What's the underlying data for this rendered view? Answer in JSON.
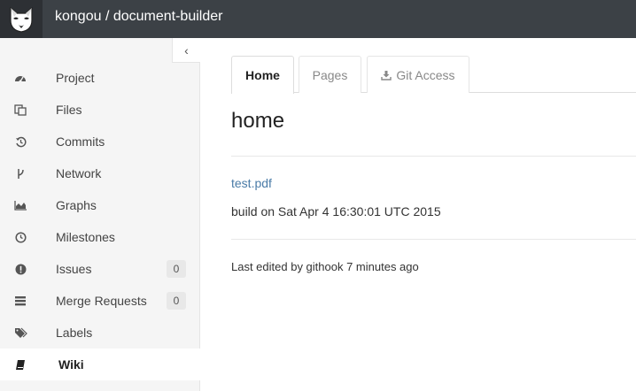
{
  "header": {
    "title": "kongou / document-builder",
    "logo_icon": "gitlab-fox-logo"
  },
  "sidebar": {
    "collapse_icon": "chevron-left-icon",
    "items": [
      {
        "label": "Project",
        "icon": "dashboard-icon"
      },
      {
        "label": "Files",
        "icon": "files-icon"
      },
      {
        "label": "Commits",
        "icon": "history-icon"
      },
      {
        "label": "Network",
        "icon": "code-fork-icon"
      },
      {
        "label": "Graphs",
        "icon": "area-chart-icon"
      },
      {
        "label": "Milestones",
        "icon": "clock-icon"
      },
      {
        "label": "Issues",
        "icon": "exclamation-circle-icon",
        "badge": "0"
      },
      {
        "label": "Merge Requests",
        "icon": "tasks-icon",
        "badge": "0"
      },
      {
        "label": "Labels",
        "icon": "tags-icon"
      },
      {
        "label": "Wiki",
        "icon": "book-icon",
        "active": true
      }
    ]
  },
  "tabs": [
    {
      "label": "Home",
      "active": true
    },
    {
      "label": "Pages",
      "active": false
    },
    {
      "label": "Git Access",
      "icon": "download-icon",
      "active": false
    }
  ],
  "content": {
    "title": "home",
    "link_text": "test.pdf",
    "build_text": "build on Sat Apr 4 16:30:01 UTC 2015",
    "edited_text": "Last edited by githook 7 minutes ago"
  },
  "colors": {
    "header_bg": "#3c4146",
    "sidebar_bg": "#f5f5f5",
    "link": "#4a7ba7"
  }
}
